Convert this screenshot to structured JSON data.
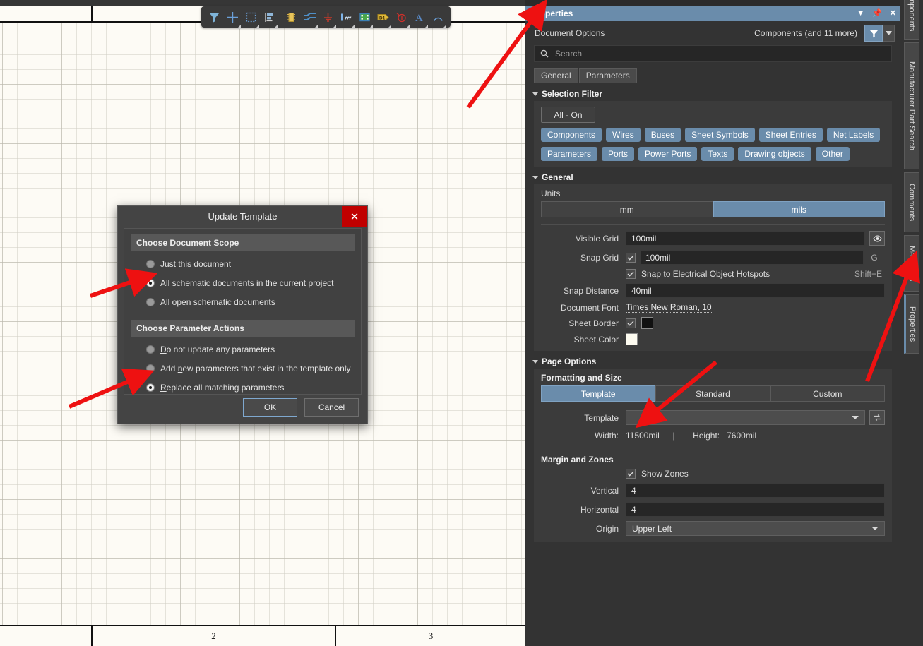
{
  "app": {
    "canvas": {
      "zone_labels_bottom": [
        "",
        "2",
        "3"
      ],
      "background_color": "#fdfbf5"
    },
    "toolbar": {
      "items": [
        {
          "name": "selection-filter-icon",
          "label": "Selection Filter",
          "has_caret": false
        },
        {
          "name": "crosshair-icon",
          "label": "Place Crosshair",
          "has_caret": true
        },
        {
          "name": "marquee-select-icon",
          "label": "Area Select",
          "has_caret": true
        },
        {
          "name": "align-icon",
          "label": "Align",
          "has_caret": true
        },
        {
          "name": "place-part-icon",
          "label": "Place Part",
          "has_caret": false
        },
        {
          "name": "place-wire-icon",
          "label": "Place Wire",
          "has_caret": true
        },
        {
          "name": "place-gnd-power-port-icon",
          "label": "Place GND Power Port",
          "has_caret": true
        },
        {
          "name": "place-net-label-icon",
          "label": "Place Net Label",
          "has_caret": true
        },
        {
          "name": "place-sheet-symbol-icon",
          "label": "Place Sheet Symbol",
          "has_caret": true
        },
        {
          "name": "place-port-icon",
          "label": "Place Port",
          "has_caret": true
        },
        {
          "name": "place-no-erc-icon",
          "label": "Place No ERC",
          "has_caret": true
        },
        {
          "name": "place-text-string-icon",
          "label": "Place Text String",
          "has_caret": true
        },
        {
          "name": "place-arc-icon",
          "label": "Place Arc",
          "has_caret": true
        }
      ]
    },
    "dialog": {
      "title": "Update Template",
      "close_label": "✕",
      "groups": [
        {
          "header": "Choose Document Scope",
          "options": [
            {
              "label": "Just this document",
              "accel": "J",
              "selected": false
            },
            {
              "label": "All schematic documents in the current project",
              "accel": "p",
              "selected": true
            },
            {
              "label": "All open schematic documents",
              "accel": "A",
              "selected": false
            }
          ]
        },
        {
          "header": "Choose Parameter Actions",
          "options": [
            {
              "label": "Do not update any parameters",
              "accel": "D",
              "selected": false
            },
            {
              "label": "Add new parameters that exist in the template only",
              "accel": "n",
              "selected": false
            },
            {
              "label": "Replace all matching parameters",
              "accel": "R",
              "selected": true
            }
          ]
        }
      ],
      "ok_label": "OK",
      "cancel_label": "Cancel"
    },
    "properties": {
      "title": "Properties",
      "doc_options_label": "Document Options",
      "filter_summary": "Components (and 11 more)",
      "search": {
        "placeholder": "Search",
        "value": ""
      },
      "tabs": [
        {
          "label": "General",
          "active": true
        },
        {
          "label": "Parameters",
          "active": false
        }
      ],
      "selection_filter": {
        "header": "Selection Filter",
        "all_button": "All - On",
        "chips": [
          "Components",
          "Wires",
          "Buses",
          "Sheet Symbols",
          "Sheet Entries",
          "Net Labels",
          "Parameters",
          "Ports",
          "Power Ports",
          "Texts",
          "Drawing objects",
          "Other"
        ]
      },
      "general": {
        "header": "General",
        "units_label": "Units",
        "units_options": [
          {
            "label": "mm",
            "selected": false
          },
          {
            "label": "mils",
            "selected": true
          }
        ],
        "visible_grid": {
          "label": "Visible Grid",
          "value": "100mil"
        },
        "snap_grid": {
          "label": "Snap Grid",
          "value": "100mil",
          "checked": true,
          "shortcut": "G"
        },
        "snap_hotspots": {
          "label": "Snap to Electrical Object Hotspots",
          "checked": true,
          "shortcut": "Shift+E"
        },
        "snap_distance": {
          "label": "Snap Distance",
          "value": "40mil"
        },
        "document_font": {
          "label": "Document Font",
          "value": "Times New Roman, 10"
        },
        "sheet_border": {
          "label": "Sheet Border",
          "checked": true,
          "color": "#111111"
        },
        "sheet_color": {
          "label": "Sheet Color",
          "color": "#fdfbf0"
        }
      },
      "page_options": {
        "header": "Page Options",
        "formatting_label": "Formatting and Size",
        "format_options": [
          {
            "label": "Template",
            "selected": true
          },
          {
            "label": "Standard",
            "selected": false
          },
          {
            "label": "Custom",
            "selected": false
          }
        ],
        "template": {
          "label": "Template",
          "value": ""
        },
        "width": {
          "label": "Width:",
          "value": "11500mil"
        },
        "height": {
          "label": "Height:",
          "value": "7600mil"
        },
        "margin_header": "Margin and Zones",
        "show_zones": {
          "label": "Show Zones",
          "checked": true
        },
        "vertical": {
          "label": "Vertical",
          "value": "4"
        },
        "horizontal": {
          "label": "Horizontal",
          "value": "4"
        },
        "origin": {
          "label": "Origin",
          "value": "Upper Left"
        }
      }
    },
    "vertical_tabs": [
      {
        "label": "Components",
        "active": false
      },
      {
        "label": "Manufacturer Part Search",
        "active": false
      },
      {
        "label": "Comments",
        "active": false
      },
      {
        "label": "Messages",
        "active": false
      },
      {
        "label": "Properties",
        "active": true
      }
    ],
    "colors": {
      "accent": "#6a8cab",
      "panel_bg": "#333333",
      "annotation_arrow": "#ee1111"
    }
  }
}
